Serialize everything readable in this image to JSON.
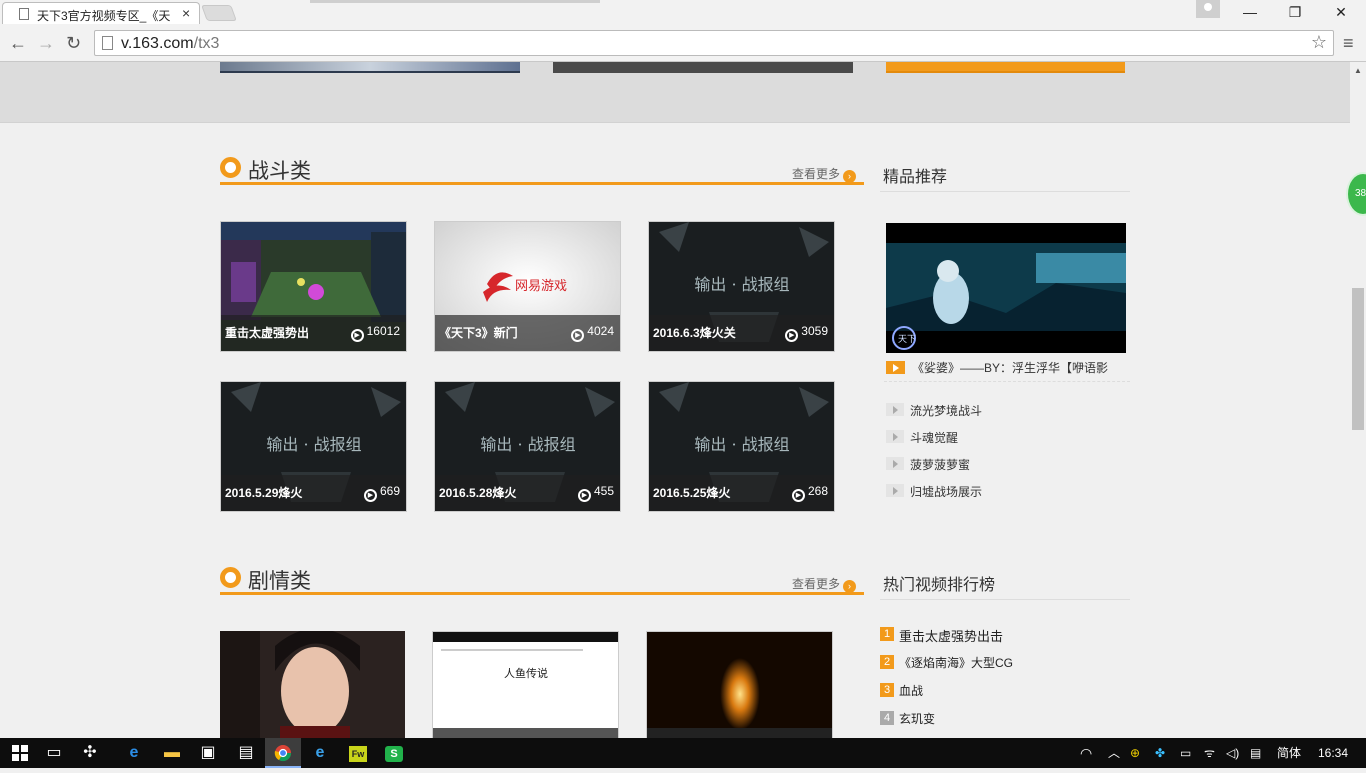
{
  "browser": {
    "tab_title": "天下3官方视频专区_《天",
    "tab_close": "×",
    "url_host": "v.163.com",
    "url_path": "/tx3",
    "window_controls": {
      "minimize": "—",
      "restore": "❐",
      "close": "✕"
    }
  },
  "section_battle": {
    "title": "战斗类",
    "more_label": "查看更多",
    "videos": [
      {
        "title": "重击太虚强势出",
        "views": "16012"
      },
      {
        "title": "《天下3》新门",
        "views": "4024"
      },
      {
        "title": "2016.6.3烽火关",
        "views": "3059"
      },
      {
        "title": "2016.5.29烽火",
        "views": "669"
      },
      {
        "title": "2016.5.28烽火",
        "views": "455"
      },
      {
        "title": "2016.5.25烽火",
        "views": "268"
      }
    ]
  },
  "section_story": {
    "title": "剧情类",
    "more_label": "查看更多"
  },
  "thumb_texts": {
    "netease_logo": "网易游戏",
    "battle_report": "输出 · 战报组",
    "story_poster": "人鱼传说",
    "feature_logo": "天下"
  },
  "recommend": {
    "title": "精品推荐",
    "feature_caption": "《娑婆》——BY：浮生浮华【咿语影",
    "items": [
      "流光梦境战斗",
      "斗魂觉醒",
      "菠萝菠萝蜜",
      "归墟战场展示"
    ]
  },
  "ranking": {
    "title": "热门视频排行榜",
    "items": [
      {
        "num": "1",
        "title": "重击太虚强势出击"
      },
      {
        "num": "2",
        "title": "《逐焰南海》大型CG"
      },
      {
        "num": "3",
        "title": "血战"
      },
      {
        "num": "4",
        "title": "玄玑变"
      }
    ]
  },
  "float_badge": "38",
  "taskbar": {
    "ime": "简体",
    "clock": "16:34"
  },
  "colors": {
    "accent": "#f29a1b",
    "caption_bg": "#1e1e1e"
  }
}
